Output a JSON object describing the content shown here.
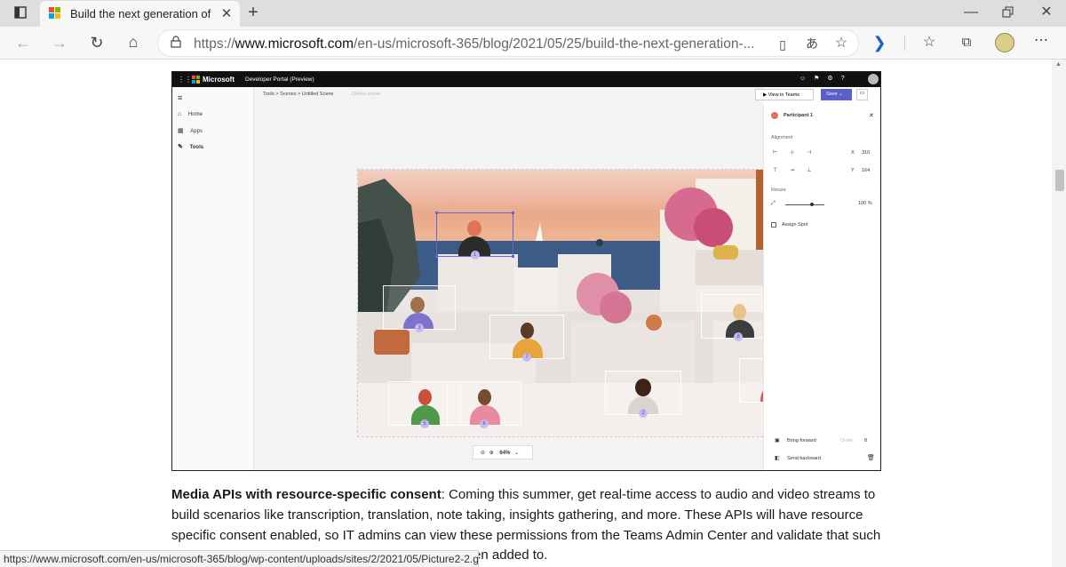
{
  "browser": {
    "tab_title": "Build the next generation of colla",
    "url_prefix": "https://",
    "url_domain": "www.microsoft.com",
    "url_path": "/en-us/microsoft-365/blog/2021/05/25/build-the-next-generation-...",
    "status_url": "https://www.microsoft.com/en-us/microsoft-365/blog/wp-content/uploads/sites/2/2021/05/Picture2-2.gif"
  },
  "devportal": {
    "brand": "Microsoft",
    "product": "Developer Portal (Preview)",
    "nav": [
      {
        "label": "Home",
        "icon": "home-icon"
      },
      {
        "label": "Apps",
        "icon": "apps-icon"
      },
      {
        "label": "Tools",
        "icon": "tools-icon"
      }
    ],
    "breadcrumb": "Tools > Scenes > Untitled Scene",
    "delete_label": "Delete scene",
    "view_in_teams": "View in Teams",
    "save_label": "Save",
    "zoom": "64%",
    "panel": {
      "participant": "Participant 1",
      "alignment": "Alignment",
      "x_label": "X",
      "x_value": "310",
      "y_label": "Y",
      "y_value": "164",
      "resize": "Resize",
      "resize_value": "100 %",
      "assign_spot": "Assign Spot",
      "bring_forward": "Bring forward",
      "order_label": "Order",
      "order_value": "8",
      "send_backward": "Send backward"
    },
    "avatars": [
      "1",
      "3",
      "7",
      "8",
      "5",
      "6",
      "2",
      "4"
    ]
  },
  "article": {
    "bold_lead": "Media APIs with resource-specific consent",
    "text": ": Coming this summer, get real-time access to audio and video streams to build scenarios like transcription, translation, note taking, insights gathering, and more. These APIs will have resource specific consent enabled, so IT admins can view these permissions from the Teams Admin Center and validate that such",
    "tail": "en added to."
  },
  "colors": {
    "accent": "#5b5fc7",
    "sky": "#e9a98a",
    "sea": "#3c5c87"
  }
}
